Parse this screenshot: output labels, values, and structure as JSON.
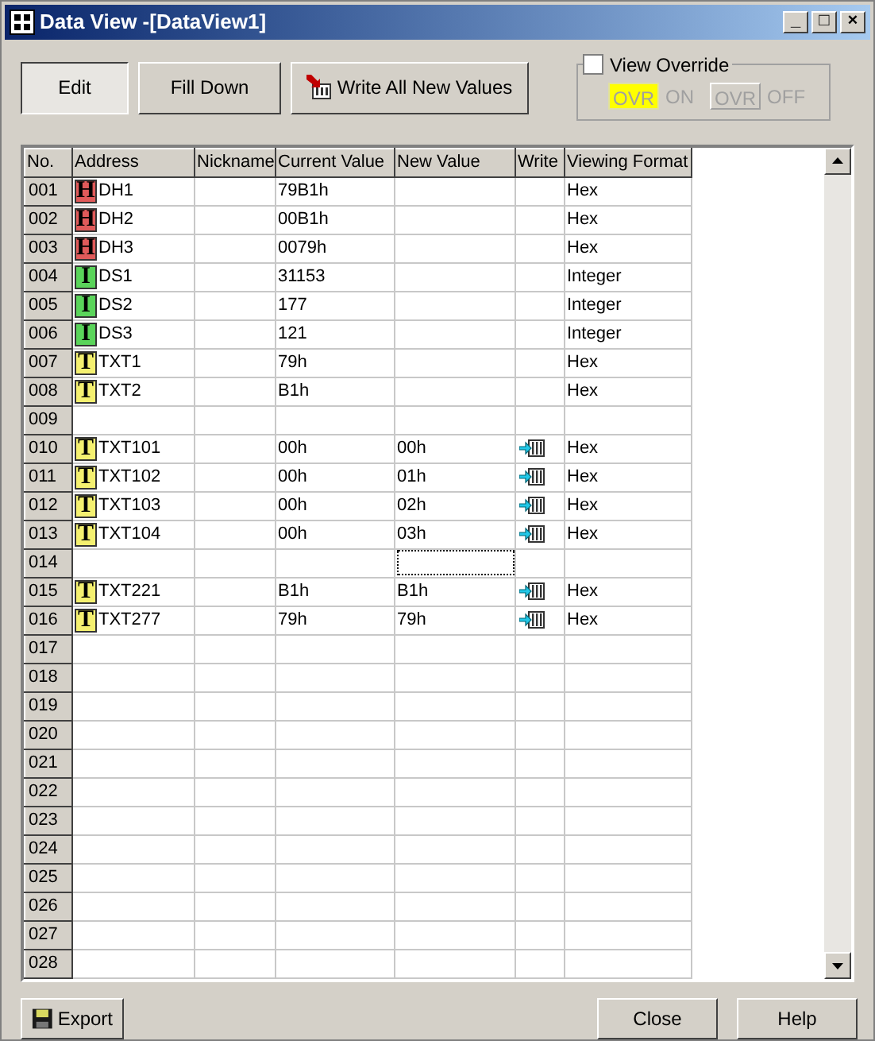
{
  "window": {
    "title": "Data View -[DataView1]",
    "controls": [
      "_",
      "□",
      "×"
    ]
  },
  "toolbar": [
    {
      "label": "Edit",
      "pressed": true,
      "kind": "plain"
    },
    {
      "label": "Fill Down",
      "pressed": false,
      "kind": "plain"
    },
    {
      "label": "Write All New Values",
      "pressed": false,
      "kind": "write"
    }
  ],
  "override": {
    "label": "View Override",
    "checked": false,
    "options": [
      {
        "badge": "OVR",
        "label": "ON",
        "selected": true
      },
      {
        "badge": "OVR",
        "label": "OFF",
        "selected": false
      }
    ]
  },
  "table": {
    "columns": [
      "No.",
      "Address",
      "Nickname",
      "Current Value",
      "New Value",
      "Write",
      "Viewing Format"
    ],
    "rows": [
      {
        "no": "001",
        "badge": "H",
        "color": "#e05a5a",
        "address": "DH1",
        "current": "79B1h",
        "format": "Hex"
      },
      {
        "no": "002",
        "badge": "H",
        "color": "#e05a5a",
        "address": "DH2",
        "current": "00B1h",
        "format": "Hex"
      },
      {
        "no": "003",
        "badge": "H",
        "color": "#e05a5a",
        "address": "DH3",
        "current": "0079h",
        "format": "Hex"
      },
      {
        "no": "004",
        "badge": "I",
        "color": "#5ad45a",
        "address": "DS1",
        "current": "31153",
        "format": "Integer"
      },
      {
        "no": "005",
        "badge": "I",
        "color": "#5ad45a",
        "address": "DS2",
        "current": "177",
        "format": "Integer"
      },
      {
        "no": "006",
        "badge": "I",
        "color": "#5ad45a",
        "address": "DS3",
        "current": "121",
        "format": "Integer"
      },
      {
        "no": "007",
        "badge": "T",
        "color": "#f4f070",
        "address": "TXT1",
        "current": "79h",
        "format": "Hex"
      },
      {
        "no": "008",
        "badge": "T",
        "color": "#f4f070",
        "address": "TXT2",
        "current": "B1h",
        "format": "Hex"
      },
      {
        "no": "009"
      },
      {
        "no": "010",
        "badge": "T",
        "color": "#f4f070",
        "address": "TXT101",
        "current": "00h",
        "new": "00h",
        "write": true,
        "format": "Hex"
      },
      {
        "no": "011",
        "badge": "T",
        "color": "#f4f070",
        "address": "TXT102",
        "current": "00h",
        "new": "01h",
        "write": true,
        "format": "Hex"
      },
      {
        "no": "012",
        "badge": "T",
        "color": "#f4f070",
        "address": "TXT103",
        "current": "00h",
        "new": "02h",
        "write": true,
        "format": "Hex"
      },
      {
        "no": "013",
        "badge": "T",
        "color": "#f4f070",
        "address": "TXT104",
        "current": "00h",
        "new": "03h",
        "write": true,
        "format": "Hex"
      },
      {
        "no": "014",
        "focused": true
      },
      {
        "no": "015",
        "badge": "T",
        "color": "#f4f070",
        "address": "TXT221",
        "current": "B1h",
        "new": "B1h",
        "write": true,
        "format": "Hex"
      },
      {
        "no": "016",
        "badge": "T",
        "color": "#f4f070",
        "address": "TXT277",
        "current": "79h",
        "new": "79h",
        "write": true,
        "format": "Hex"
      },
      {
        "no": "017"
      },
      {
        "no": "018"
      },
      {
        "no": "019"
      },
      {
        "no": "020"
      },
      {
        "no": "021"
      },
      {
        "no": "022"
      },
      {
        "no": "023"
      },
      {
        "no": "024"
      },
      {
        "no": "025"
      },
      {
        "no": "026"
      },
      {
        "no": "027"
      },
      {
        "no": "028"
      }
    ]
  },
  "footer": {
    "left": [
      {
        "label": "Export"
      }
    ],
    "right": [
      {
        "label": "Close"
      },
      {
        "label": "Help"
      }
    ]
  }
}
